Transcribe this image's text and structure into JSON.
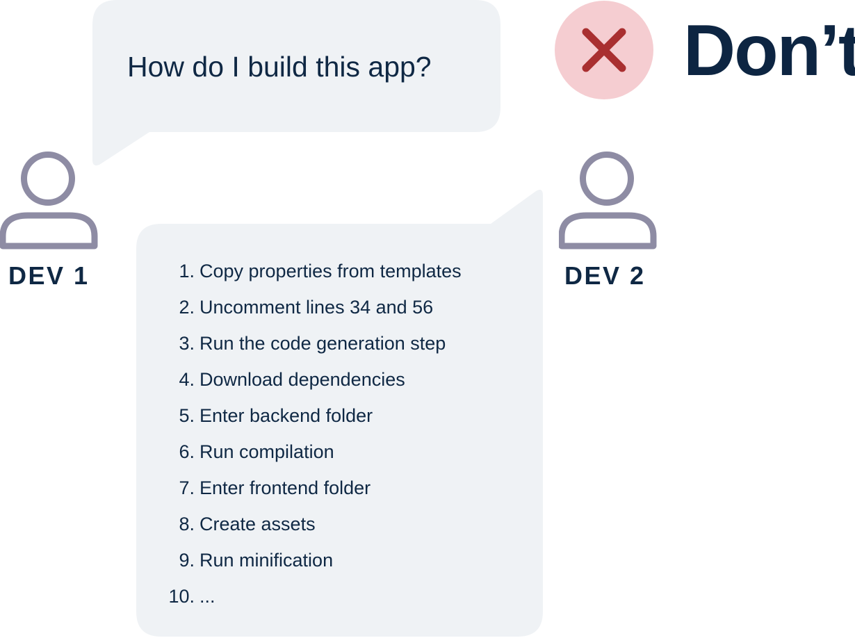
{
  "question_bubble": {
    "text": "How do I build this app?"
  },
  "answer_bubble": {
    "steps": [
      {
        "number": "1.",
        "text": "Copy properties from templates"
      },
      {
        "number": "2.",
        "text": "Uncomment lines 34 and 56"
      },
      {
        "number": "3.",
        "text": "Run the code generation step"
      },
      {
        "number": "4.",
        "text": "Download dependencies"
      },
      {
        "number": "5.",
        "text": "Enter backend folder"
      },
      {
        "number": "6.",
        "text": "Run compilation"
      },
      {
        "number": "7.",
        "text": "Enter frontend folder"
      },
      {
        "number": "8.",
        "text": "Create assets"
      },
      {
        "number": "9.",
        "text": "Run minification"
      },
      {
        "number": "10.",
        "text": "..."
      }
    ]
  },
  "dev1": {
    "label": "DEV 1",
    "icon": "person-icon"
  },
  "dev2": {
    "label": "DEV 2",
    "icon": "person-icon"
  },
  "verdict": {
    "label": "Don’t",
    "icon": "x-icon"
  },
  "colors": {
    "bubble_fill": "#eff2f5",
    "text_dark": "#0f2844",
    "avatar_stroke": "#8e8ca4",
    "dont_circle": "#f5cdd1",
    "dont_x": "#a92f30"
  }
}
